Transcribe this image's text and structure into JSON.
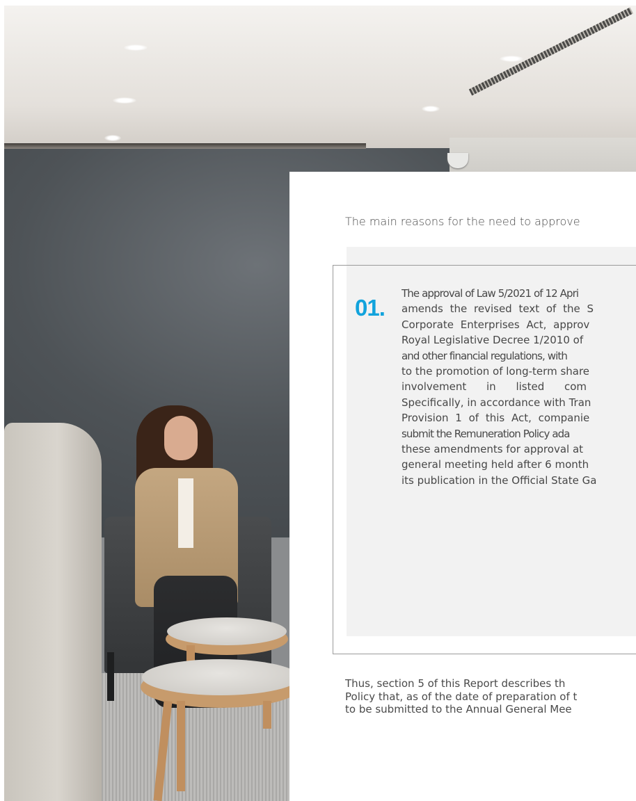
{
  "photo": {
    "subject": "woman-seated-in-armchair-office-lounge"
  },
  "content": {
    "intro": "The main reasons for the need to approve",
    "item": {
      "number": "01.",
      "number_color": "#12a3dc",
      "lines": [
        "The approval of Law 5/2021 of 12 Apri",
        "amends the revised text of the S",
        "Corporate Enterprises Act, approv",
        "Royal Legislative Decree 1/2010 of",
        "and other financial regulations, with",
        "to the promotion of long-term share",
        "involvement in listed com",
        "Specifically, in accordance with Tran",
        "Provision 1 of this Act, companie",
        "submit the Remuneration Policy ada",
        "these amendments for approval at",
        "general meeting held after 6 month",
        "its publication in the Official State Ga"
      ]
    },
    "closing": [
      "Thus, section 5 of this Report describes th",
      "Policy that, as of the date of preparation of t",
      "to be submitted to the Annual General Mee"
    ]
  }
}
